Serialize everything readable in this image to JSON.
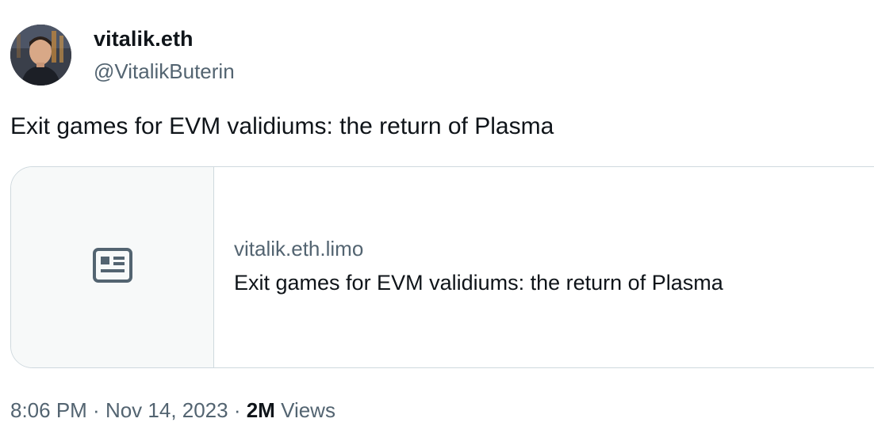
{
  "author": {
    "display_name": "vitalik.eth",
    "handle": "@VitalikButerin"
  },
  "tweet": {
    "text": "Exit games for EVM validiums: the return of Plasma"
  },
  "link_card": {
    "icon": "article-icon",
    "domain": "vitalik.eth.limo",
    "title": "Exit games for EVM validiums: the return of Plasma"
  },
  "meta": {
    "time": "8:06 PM",
    "separator": " · ",
    "date": "Nov 14, 2023",
    "views_count": "2M",
    "views_label": " Views"
  },
  "colors": {
    "text_primary": "#0f1419",
    "text_secondary": "#536471",
    "border": "#cfd9de",
    "card_thumb_bg": "#f7f9f9"
  }
}
